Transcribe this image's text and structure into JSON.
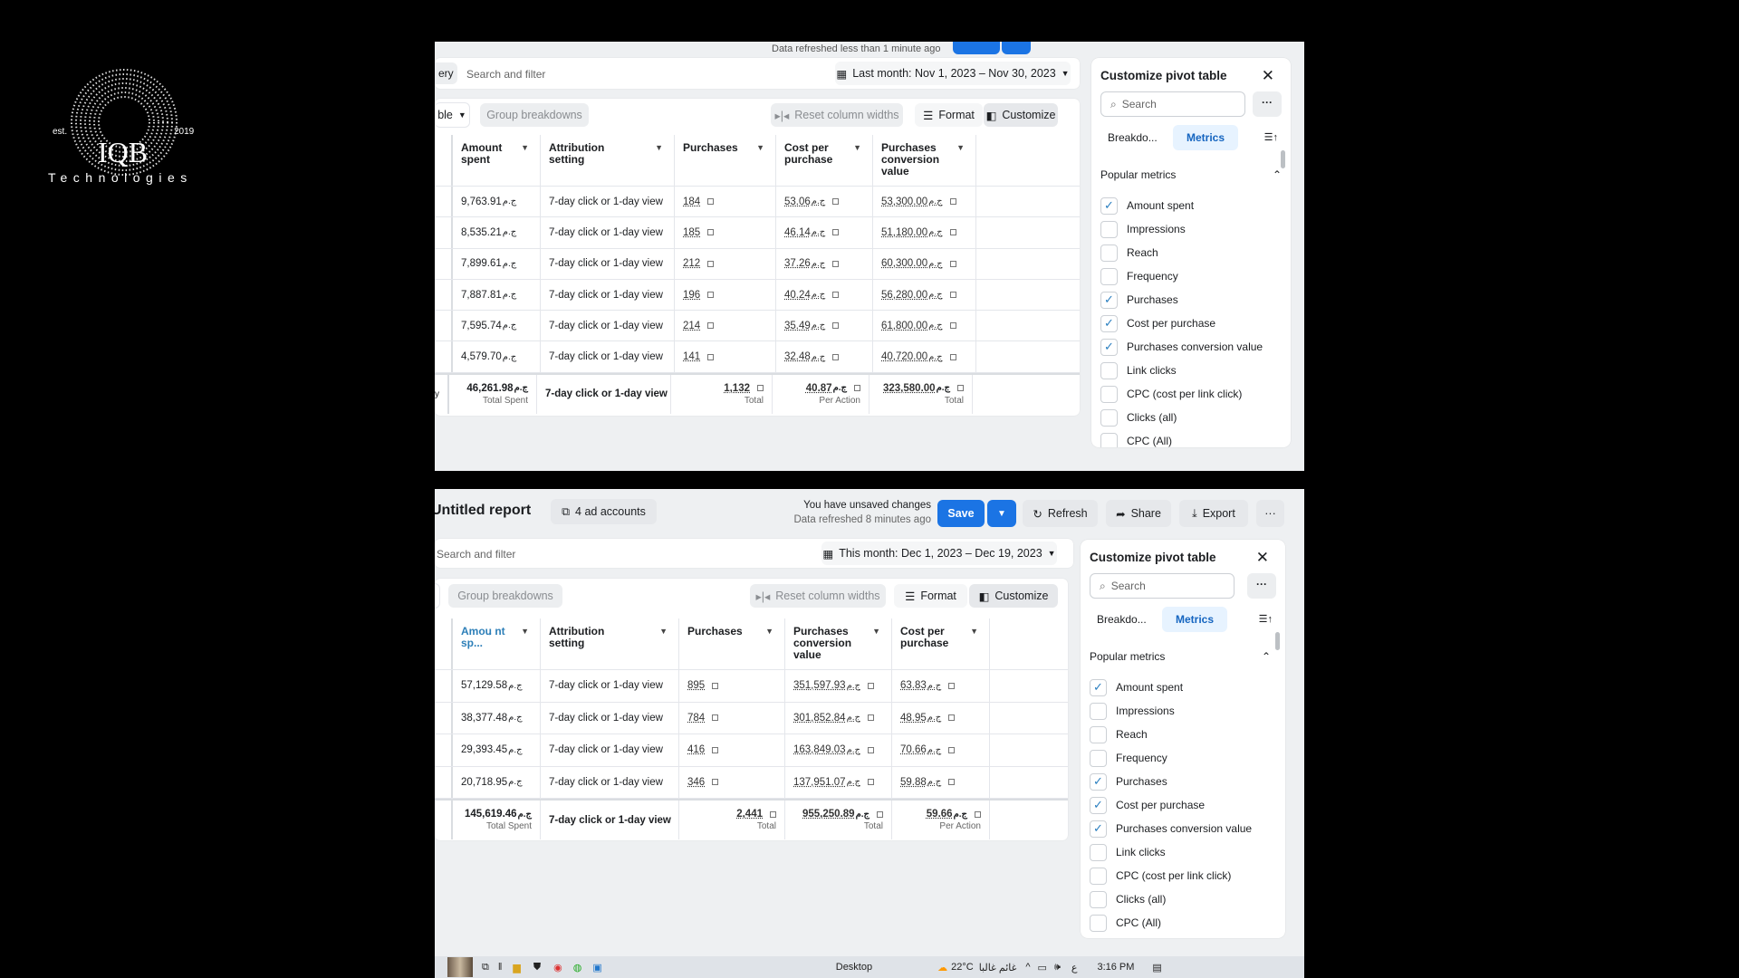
{
  "logo": {
    "est": "est.",
    "year": "2019",
    "name": "IQB",
    "tagline": "Technologies"
  },
  "currency": "ج.م",
  "colors": {
    "accent": "#1b74e4",
    "tab_active_bg": "#e7f3ff",
    "check": "#2a7fc0"
  },
  "top": {
    "refresh_status": "Data refreshed less than 1 minute ago",
    "search_prefix": "ery",
    "search_placeholder": "Search and filter",
    "date_range": "Last month: Nov 1, 2023 – Nov 30, 2023",
    "view_select": "ble",
    "toolbar": {
      "group": "Group breakdowns",
      "reset": "Reset column widths",
      "format": "Format",
      "customize": "Customize"
    },
    "columns": [
      {
        "label": "Amount spent"
      },
      {
        "label": "Attribution setting"
      },
      {
        "label": "Purchases"
      },
      {
        "label": "Cost per purchase"
      },
      {
        "label": "Purchases conversion value"
      }
    ],
    "col_types": [
      "money",
      "text",
      "link",
      "linkmoney",
      "linkmoney"
    ],
    "rows": [
      [
        "9,763.91",
        "7-day click or 1-day view",
        "184",
        "53.06",
        "53,300.00"
      ],
      [
        "8,535.21",
        "7-day click or 1-day view",
        "185",
        "46.14",
        "51,180.00"
      ],
      [
        "7,899.61",
        "7-day click or 1-day view",
        "212",
        "37.26",
        "60,300.00"
      ],
      [
        "7,887.81",
        "7-day click or 1-day view",
        "196",
        "40.24",
        "56,280.00"
      ],
      [
        "7,595.74",
        "7-day click or 1-day view",
        "214",
        "35.49",
        "61,800.00"
      ],
      [
        "4,579.70",
        "7-day click or 1-day view",
        "141",
        "32.48",
        "40,720.00"
      ]
    ],
    "totals": [
      {
        "value": "46,261.98",
        "sub": "Total Spent"
      },
      {
        "value": "7-day click or 1-day view"
      },
      {
        "value": "1,132",
        "sub": "Total"
      },
      {
        "value": "40.87",
        "sub": "Per Action"
      },
      {
        "value": "323,580.00",
        "sub": "Total"
      }
    ],
    "total_prefix": "y"
  },
  "bottom": {
    "title": "Untitled report",
    "accounts": "4 ad accounts",
    "unsaved": "You have unsaved changes",
    "refresh_status": "Data refreshed 8 minutes ago",
    "actions": {
      "save": "Save",
      "refresh": "Refresh",
      "share": "Share",
      "export": "Export"
    },
    "search_placeholder": "Search and filter",
    "date_range": "This month: Dec 1, 2023 – Dec 19, 2023",
    "toolbar": {
      "group": "Group breakdowns",
      "reset": "Reset column widths",
      "format": "Format",
      "customize": "Customize"
    },
    "columns": [
      {
        "label": "Amou nt sp...",
        "sorted": "descending"
      },
      {
        "label": "Attribution setting"
      },
      {
        "label": "Purchases"
      },
      {
        "label": "Purchases conversion value"
      },
      {
        "label": "Cost per purchase"
      }
    ],
    "col_types": [
      "money",
      "text",
      "link",
      "linkmoney",
      "linkmoney"
    ],
    "rows": [
      [
        "57,129.58",
        "7-day click or 1-day view",
        "895",
        "351,597.93",
        "63.83"
      ],
      [
        "38,377.48",
        "7-day click or 1-day view",
        "784",
        "301,852.84",
        "48.95"
      ],
      [
        "29,393.45",
        "7-day click or 1-day view",
        "416",
        "163,849.03",
        "70.66"
      ],
      [
        "20,718.95",
        "7-day click or 1-day view",
        "346",
        "137,951.07",
        "59.88"
      ]
    ],
    "totals": [
      {
        "value": "145,619.46",
        "sub": "Total Spent"
      },
      {
        "value": "7-day click or 1-day view"
      },
      {
        "value": "2,441",
        "sub": "Total"
      },
      {
        "value": "955,250.89",
        "sub": "Total"
      },
      {
        "value": "59.66",
        "sub": "Per Action"
      }
    ]
  },
  "customize_panel": {
    "title": "Customize pivot table",
    "search_placeholder": "Search",
    "tabs": [
      "Breakdo...",
      "Metrics"
    ],
    "active_tab": "Metrics",
    "section": "Popular metrics",
    "metrics": [
      {
        "label": "Amount spent",
        "checked": true
      },
      {
        "label": "Impressions",
        "checked": false
      },
      {
        "label": "Reach",
        "checked": false
      },
      {
        "label": "Frequency",
        "checked": false
      },
      {
        "label": "Purchases",
        "checked": true
      },
      {
        "label": "Cost per purchase",
        "checked": true
      },
      {
        "label": "Purchases conversion value",
        "checked": true
      },
      {
        "label": "Link clicks",
        "checked": false
      },
      {
        "label": "CPC (cost per link click)",
        "checked": false
      },
      {
        "label": "Clicks (all)",
        "checked": false
      },
      {
        "label": "CPC (All)",
        "checked": false
      }
    ]
  },
  "taskbar": {
    "desktop": "Desktop",
    "weather": "22°C",
    "weather_text": "غائم غالبا",
    "lang": "ع",
    "time": "3:16 PM"
  }
}
